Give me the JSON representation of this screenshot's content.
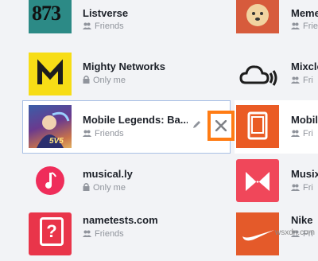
{
  "left_apps": [
    {
      "name": "Listverse",
      "privacy": "Friends",
      "privacy_icon": "friends-icon",
      "thumb_text": "873"
    },
    {
      "name": "Mighty Networks",
      "privacy": "Only me",
      "privacy_icon": "lock-icon"
    },
    {
      "name": "Mobile Legends: Ba...",
      "privacy": "Friends",
      "privacy_icon": "friends-icon",
      "thumb_text": "5V5"
    },
    {
      "name": "musical.ly",
      "privacy": "Only me",
      "privacy_icon": "lock-icon"
    },
    {
      "name": "nametests.com",
      "privacy": "Friends",
      "privacy_icon": "friends-icon",
      "thumb_text": "?"
    }
  ],
  "right_apps": [
    {
      "name": "Meme",
      "privacy": "Frie",
      "privacy_icon": "friends-icon"
    },
    {
      "name": "Mixclo",
      "privacy": "Fri",
      "privacy_icon": "friends-icon"
    },
    {
      "name": "Mobil",
      "privacy": "Fri",
      "privacy_icon": "friends-icon"
    },
    {
      "name": "Musix",
      "privacy": "Fri",
      "privacy_icon": "friends-icon"
    },
    {
      "name": "Nike",
      "privacy": "Fri",
      "privacy_icon": "friends-icon"
    }
  ],
  "watermark": "wsxdn.com",
  "colors": {
    "highlight": "#ff7c14",
    "selected_border": "#a9c0e5"
  }
}
